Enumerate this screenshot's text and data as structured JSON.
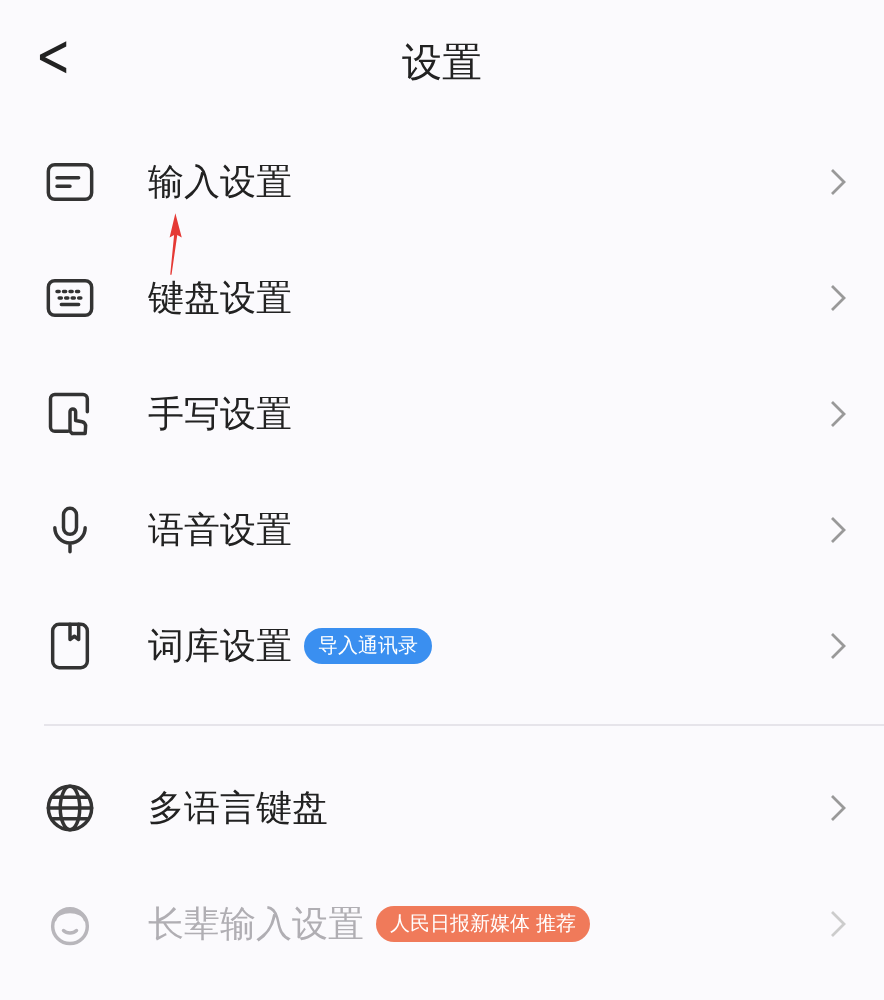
{
  "header": {
    "back_icon": "<",
    "title": "设置"
  },
  "groups": [
    {
      "items": [
        {
          "label": "输入设置",
          "dimmed": false
        },
        {
          "label": "键盘设置",
          "dimmed": false
        },
        {
          "label": "手写设置",
          "dimmed": false
        },
        {
          "label": "语音设置",
          "dimmed": false
        },
        {
          "label": "词库设置",
          "badge": {
            "text": "导入通讯录",
            "color": "#3a8ff0"
          },
          "dimmed": false
        }
      ]
    },
    {
      "items": [
        {
          "label": "多语言键盘",
          "dimmed": false
        },
        {
          "label": "长辈输入设置",
          "badge": {
            "text": "人民日报新媒体 推荐",
            "color": "#f07a5a"
          },
          "dimmed": true
        }
      ]
    }
  ]
}
